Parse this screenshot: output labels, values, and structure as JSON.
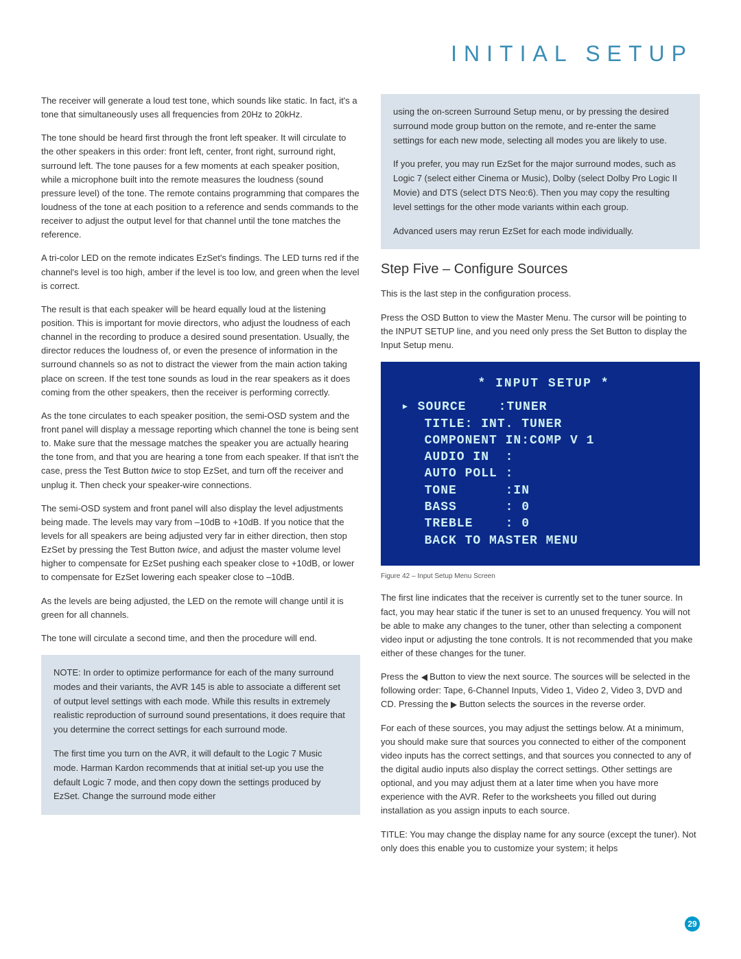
{
  "header": {
    "title": "INITIAL SETUP"
  },
  "left": {
    "p1": "The receiver will generate a loud test tone, which sounds like static. In fact, it's a tone that simultaneously uses all frequencies from 20Hz to 20kHz.",
    "p2": "The tone should be heard first through the front left speaker. It will circulate to the other speakers in this order: front left, center, front right, surround right, surround left. The tone pauses for a few moments at each speaker position, while a microphone built into the remote measures the loudness (sound pressure level) of the tone. The remote contains programming that compares the loudness of the tone at each position to a reference and sends commands to the receiver to adjust the output level for that channel until the tone matches the reference.",
    "p3": "A tri-color LED on the remote indicates EzSet's findings. The LED turns red if the channel's level is too high, amber if the level is too low, and green when the level is correct.",
    "p4": "The result is that each speaker will be heard equally loud at the listening position. This is important for movie directors, who adjust the loudness of each channel in the recording to produce a desired sound presentation. Usually, the director reduces the loudness of, or even the presence of information in the surround channels so as not to distract the viewer from the main action taking place on screen. If the test tone sounds as loud in the rear speakers as it does coming from the other speakers, then the receiver is performing correctly.",
    "p5a": "As the tone circulates to each speaker position, the semi-OSD system and the front panel will display a message reporting which channel the tone is being sent to. Make sure that the message matches the speaker you are actually hearing the tone from, and that you are hearing a tone from each speaker. If that isn't the case, press the Test Button ",
    "p5em": "twice",
    "p5b": " to stop EzSet, and turn off the receiver and unplug it. Then check your speaker-wire connections.",
    "p6a": "The semi-OSD system and front panel will also display the level adjustments being made. The levels may vary from –10dB to +10dB. If you notice that the levels for all speakers are being adjusted very far in either direction, then stop EzSet by pressing the Test Button ",
    "p6em": "twice",
    "p6b": ", and adjust the master volume level higher to compensate for EzSet pushing each speaker close to +10dB, or lower to compensate for EzSet lowering each speaker close to –10dB.",
    "p7": "As the levels are being adjusted, the LED on the remote will change until it is green for all channels.",
    "p8": "The tone will circulate a second time, and then the procedure will end."
  },
  "note": {
    "label": "NOTE:",
    "p1": " In order to optimize performance for each of the many surround modes and their variants, the AVR 145 is able to associate a different set of output level settings with each mode. While this results in extremely realistic reproduction of surround sound presentations, it does require that you determine the correct settings for each surround mode.",
    "p2": "The first time you turn on the AVR, it will default to the Logic 7 Music mode. Harman Kardon recommends that at initial set-up you use the default Logic 7 mode, and then copy down the settings produced by EzSet. Change the surround mode either",
    "p3": "using the on-screen Surround Setup menu, or by pressing the desired surround mode group button on the remote, and re-enter the same settings for each new mode, selecting all modes you are likely to use.",
    "p4": "If you prefer, you may run EzSet for the major surround modes, such as Logic 7 (select either Cinema or Music), Dolby (select Dolby Pro Logic II Movie) and DTS (select DTS Neo:6). Then you may copy the resulting level settings for the other mode variants within each group.",
    "p5": "Advanced users may rerun EzSet for each mode individually."
  },
  "right": {
    "step_heading": "Step Five – Configure Sources",
    "p1": "This is the last step in the configuration process.",
    "p2": "Press the OSD Button to view the Master Menu. The cursor will be pointing to the INPUT SETUP line, and you need only press the Set Button to display the Input Setup menu.",
    "fig_caption": "Figure 42 – Input Setup Menu Screen",
    "p3": "The first line indicates that the receiver is currently set to the tuner source. In fact, you may hear static if the tuner is set to an unused frequency. You will not be able to make any changes to the tuner, other than selecting a component video input or adjusting the tone controls. It is not recommended that you make either of these changes for the tuner.",
    "p4a": "Press the ",
    "p4b": " Button to view the next source. The sources will be selected in the following order: Tape, 6-Channel Inputs, Video 1, Video 2, Video 3, DVD and CD. Pressing the ",
    "p4c": " Button selects the sources in the reverse order.",
    "p5": "For each of these sources, you may adjust the settings below. At a minimum, you should make sure that sources you connected to either of the component video inputs has the correct settings, and that sources you connected to any of the digital audio inputs also display the correct settings. Other settings are optional, and you may adjust them at a later time when you have more experience with the AVR. Refer to the worksheets you filled out during installation as you assign inputs to each source.",
    "p6": "TITLE: You may change the display name for any source (except the tuner). Not only does this enable you to customize your system; it helps"
  },
  "osd": {
    "title": "* INPUT SETUP *",
    "r1": "▸ SOURCE    :TUNER",
    "r2": "  TITLE: INT. TUNER",
    "r3": "  COMPONENT IN:COMP V 1",
    "r4": "  AUDIO IN  :",
    "r5": "  AUTO POLL :",
    "r6": "  TONE      :IN",
    "r7": "  BASS      : 0",
    "r8": "  TREBLE    : 0",
    "r9": "  BACK TO MASTER MENU"
  },
  "page_number": "29"
}
